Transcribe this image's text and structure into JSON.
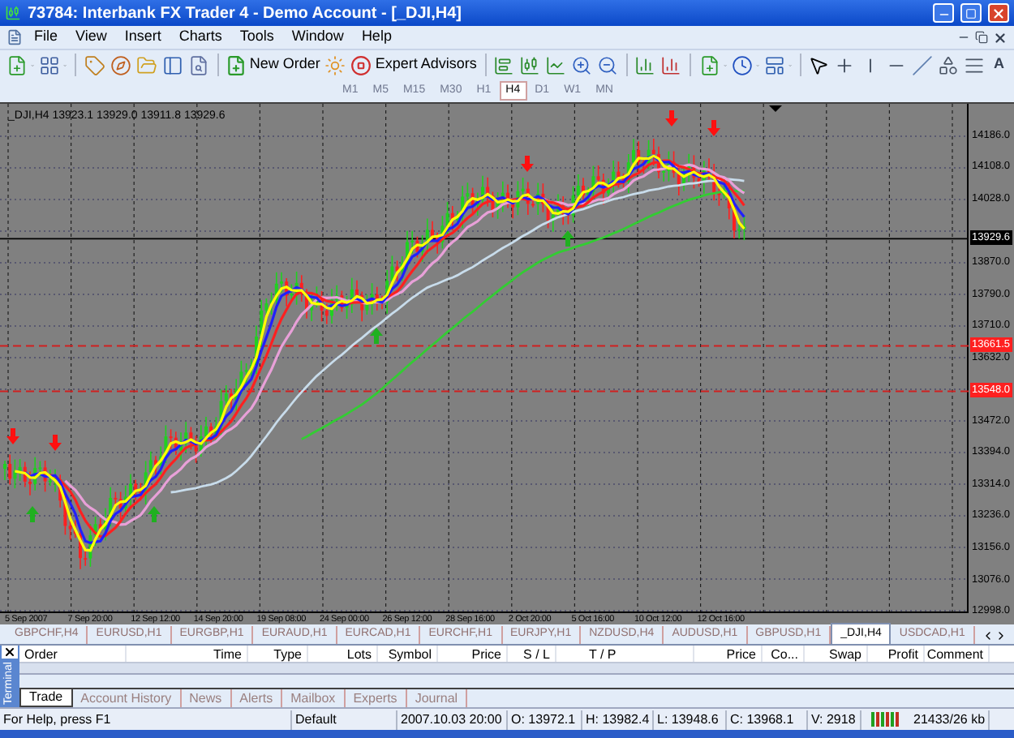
{
  "window": {
    "title": "73784: Interbank FX Trader 4 - Demo Account - [_DJI,H4]"
  },
  "menu": [
    "File",
    "View",
    "Insert",
    "Charts",
    "Tools",
    "Window",
    "Help"
  ],
  "toolbar": {
    "new_order": "New Order",
    "expert_advisors": "Expert Advisors",
    "text_tool": "A"
  },
  "timeframes": [
    {
      "label": "M1",
      "selected": false
    },
    {
      "label": "M5",
      "selected": false
    },
    {
      "label": "M15",
      "selected": false
    },
    {
      "label": "M30",
      "selected": false
    },
    {
      "label": "H1",
      "selected": false
    },
    {
      "label": "H4",
      "selected": true
    },
    {
      "label": "D1",
      "selected": false
    },
    {
      "label": "W1",
      "selected": false
    },
    {
      "label": "MN",
      "selected": false
    }
  ],
  "chart": {
    "header": "_DJI,H4  13923.1 13929.0 13911.8 13929.6",
    "price_labels": [
      {
        "text": "14186.0",
        "kind": "grid"
      },
      {
        "text": "14108.0",
        "kind": "grid"
      },
      {
        "text": "14028.0",
        "kind": "grid"
      },
      {
        "text": "13929.6",
        "kind": "current"
      },
      {
        "text": "13870.0",
        "kind": "grid"
      },
      {
        "text": "13790.0",
        "kind": "grid"
      },
      {
        "text": "13710.0",
        "kind": "grid"
      },
      {
        "text": "13661.5",
        "kind": "level"
      },
      {
        "text": "13632.0",
        "kind": "grid"
      },
      {
        "text": "13548.0",
        "kind": "level"
      },
      {
        "text": "13472.0",
        "kind": "grid"
      },
      {
        "text": "13394.0",
        "kind": "grid"
      },
      {
        "text": "13314.0",
        "kind": "grid"
      },
      {
        "text": "13236.0",
        "kind": "grid"
      },
      {
        "text": "13156.0",
        "kind": "grid"
      },
      {
        "text": "13076.0",
        "kind": "grid"
      },
      {
        "text": "12998.0",
        "kind": "grid"
      }
    ],
    "time_labels": [
      "5 Sep 2007",
      "7 Sep 20:00",
      "12 Sep 12:00",
      "14 Sep 20:00",
      "19 Sep 08:00",
      "24 Sep 00:00",
      "26 Sep 12:00",
      "28 Sep 16:00",
      "2 Oct 20:00",
      "5 Oct 16:00",
      "10 Oct 12:00",
      "12 Oct 16:00"
    ]
  },
  "chart_tabs": [
    {
      "label": "GBPCHF,H4",
      "selected": false
    },
    {
      "label": "EURUSD,H1",
      "selected": false
    },
    {
      "label": "EURGBP,H1",
      "selected": false
    },
    {
      "label": "EURAUD,H1",
      "selected": false
    },
    {
      "label": "EURCAD,H1",
      "selected": false
    },
    {
      "label": "EURCHF,H1",
      "selected": false
    },
    {
      "label": "EURJPY,H1",
      "selected": false
    },
    {
      "label": "NZDUSD,H4",
      "selected": false
    },
    {
      "label": "AUDUSD,H1",
      "selected": false
    },
    {
      "label": "GBPUSD,H1",
      "selected": false
    },
    {
      "label": "_DJI,H4",
      "selected": true
    },
    {
      "label": "USDCAD,H1",
      "selected": false
    }
  ],
  "terminal": {
    "side_label": "Terminal",
    "columns": [
      "Order",
      "Time",
      "Type",
      "Lots",
      "Symbol",
      "Price",
      "S / L",
      "T / P",
      "Price",
      "Co...",
      "Swap",
      "Profit",
      "Comment"
    ],
    "tabs": [
      {
        "label": "Trade",
        "selected": true
      },
      {
        "label": "Account History",
        "selected": false
      },
      {
        "label": "News",
        "selected": false
      },
      {
        "label": "Alerts",
        "selected": false
      },
      {
        "label": "Mailbox",
        "selected": false
      },
      {
        "label": "Experts",
        "selected": false
      },
      {
        "label": "Journal",
        "selected": false
      }
    ]
  },
  "status_bar": [
    "For Help, press F1",
    "Default",
    "2007.10.03 20:00",
    "O: 13972.1",
    "H: 13982.4",
    "L: 13948.6",
    "C: 13968.1",
    "V: 2918",
    "21433/26 kb"
  ]
}
